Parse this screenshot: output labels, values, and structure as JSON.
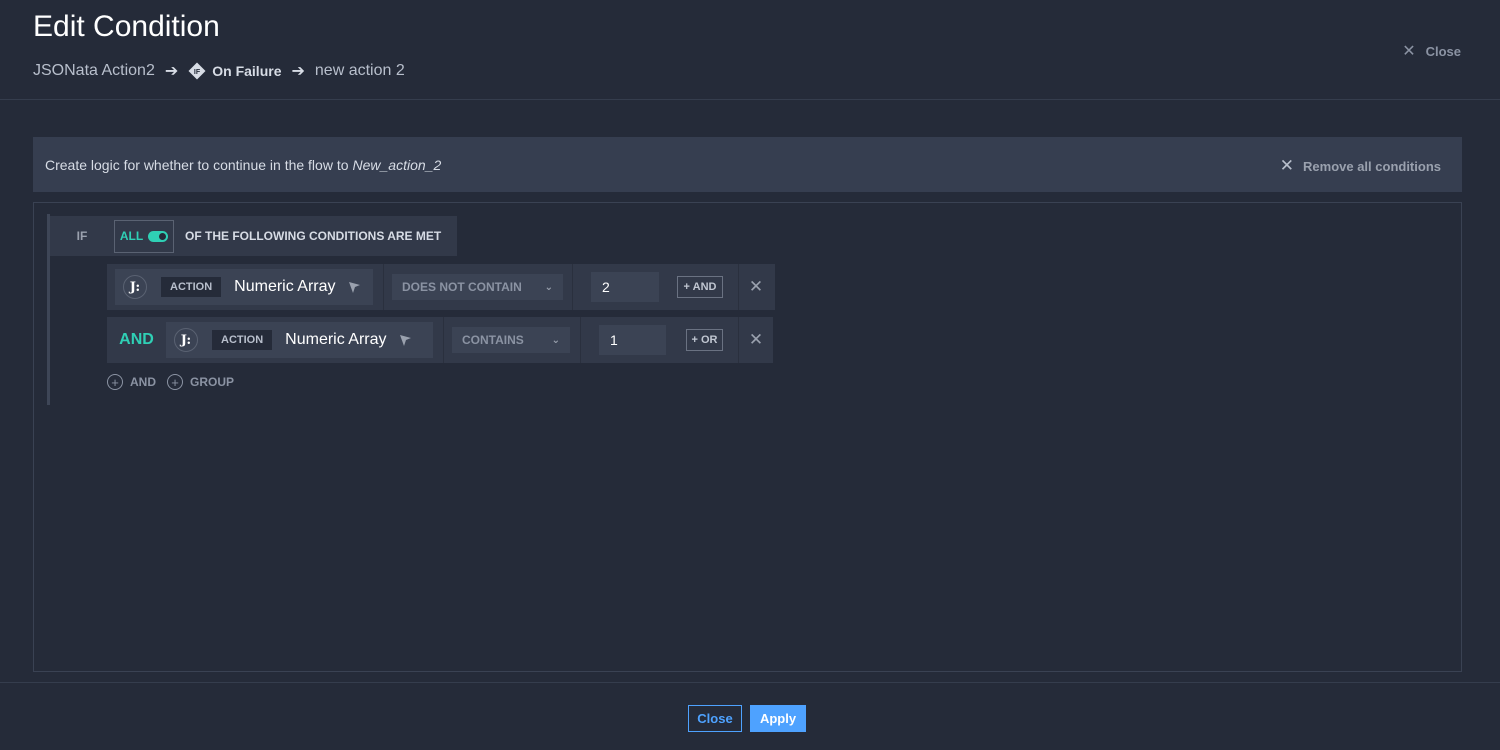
{
  "header": {
    "title": "Edit Condition",
    "breadcrumb": [
      "JSONata Action2",
      "On Failure",
      "new action 2"
    ],
    "close_label": "Close"
  },
  "banner": {
    "text": "Create logic for whether to continue in the flow to",
    "target": "New_action_2",
    "remove_all_label": "Remove all conditions"
  },
  "condition_group": {
    "if_label": "IF",
    "match_mode": "ALL",
    "match_text": "OF THE FOLLOWING CONDITIONS ARE MET",
    "rows": [
      {
        "connector": "",
        "source_icon": "J:",
        "source_badge": "ACTION",
        "field": "Numeric Array",
        "operator": "DOES NOT CONTAIN",
        "value": "2",
        "add_label": "+ AND"
      },
      {
        "connector": "AND",
        "source_icon": "J:",
        "source_badge": "ACTION",
        "field": "Numeric Array",
        "operator": "CONTAINS",
        "value": "1",
        "add_label": "+ OR"
      }
    ],
    "add_and_label": "AND",
    "add_group_label": "GROUP"
  },
  "footer": {
    "close_label": "Close",
    "apply_label": "Apply"
  },
  "colors": {
    "background": "#252b39",
    "accent": "#2fd0b5",
    "primary": "#4ea2ff"
  }
}
